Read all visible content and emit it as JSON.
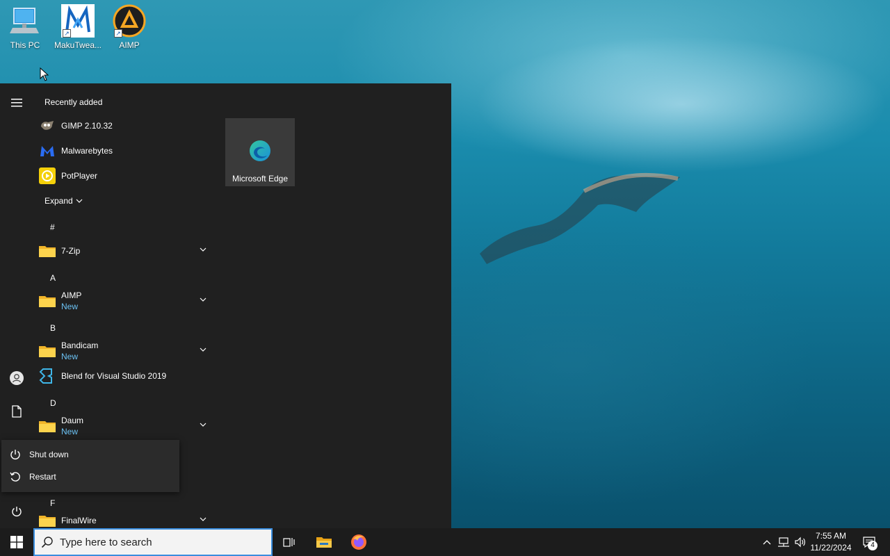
{
  "desktop": {
    "icons": [
      {
        "label": "This PC",
        "icon": "computer-icon"
      },
      {
        "label": "MakuTwea...",
        "icon": "makutweaker-icon"
      },
      {
        "label": "AIMP",
        "icon": "aimp-icon"
      }
    ]
  },
  "start_menu": {
    "recently_added_title": "Recently added",
    "recent_apps": [
      {
        "name": "GIMP 2.10.32",
        "icon": "gimp-icon"
      },
      {
        "name": "Malwarebytes",
        "icon": "malwarebytes-icon"
      },
      {
        "name": "PotPlayer",
        "icon": "potplayer-icon"
      }
    ],
    "expand_label": "Expand",
    "groups": [
      {
        "letter": "#",
        "apps": [
          {
            "name": "7-Zip",
            "badge": "",
            "folder": true
          }
        ]
      },
      {
        "letter": "A",
        "apps": [
          {
            "name": "AIMP",
            "badge": "New",
            "folder": true
          }
        ]
      },
      {
        "letter": "B",
        "apps": [
          {
            "name": "Bandicam",
            "badge": "New",
            "folder": true
          },
          {
            "name": "Blend for Visual Studio 2019",
            "badge": "",
            "folder": false
          }
        ]
      },
      {
        "letter": "D",
        "apps": [
          {
            "name": "Daum",
            "badge": "New",
            "folder": true
          }
        ]
      },
      {
        "letter": "F",
        "apps": [
          {
            "name": "FinalWire",
            "badge": "",
            "folder": true
          }
        ]
      }
    ],
    "tiles": [
      {
        "label": "Microsoft Edge",
        "icon": "edge-icon"
      }
    ],
    "power_menu": {
      "shutdown_label": "Shut down",
      "restart_label": "Restart"
    }
  },
  "taskbar": {
    "search_placeholder": "Type here to search",
    "pinned": [
      "task-view-icon",
      "file-explorer-icon",
      "firefox-icon"
    ],
    "clock_time": "7:55 AM",
    "clock_date": "11/22/2024",
    "notification_count": "4"
  },
  "colors": {
    "menu_bg": "#202020",
    "accent_new": "#6cc3f5",
    "search_border": "#3a8dde",
    "taskbar_bg": "#1c1c1c"
  }
}
